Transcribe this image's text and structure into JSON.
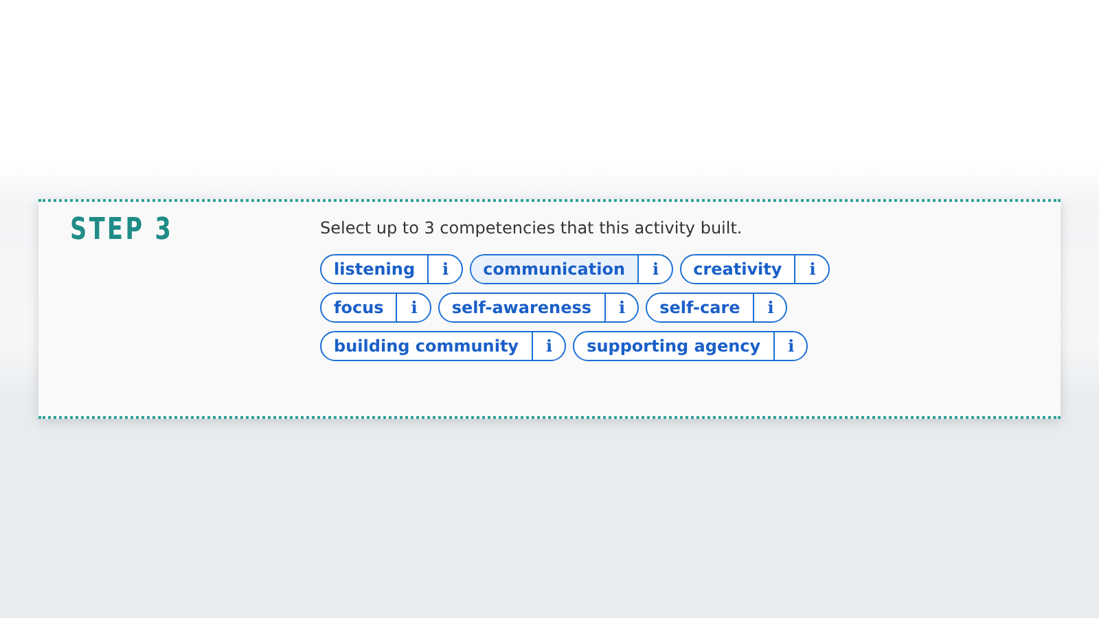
{
  "step": {
    "title": "STEP 3",
    "prompt": "Select up to 3 competencies that this activity built.",
    "chips": [
      {
        "label": "listening",
        "info": "i",
        "selected": false
      },
      {
        "label": "communication",
        "info": "i",
        "selected": true
      },
      {
        "label": "creativity",
        "info": "i",
        "selected": false
      },
      {
        "label": "focus",
        "info": "i",
        "selected": false
      },
      {
        "label": "self-awareness",
        "info": "i",
        "selected": false
      },
      {
        "label": "self-care",
        "info": "i",
        "selected": false
      },
      {
        "label": "building community",
        "info": "i",
        "selected": false
      },
      {
        "label": "supporting agency",
        "info": "i",
        "selected": false
      }
    ]
  }
}
